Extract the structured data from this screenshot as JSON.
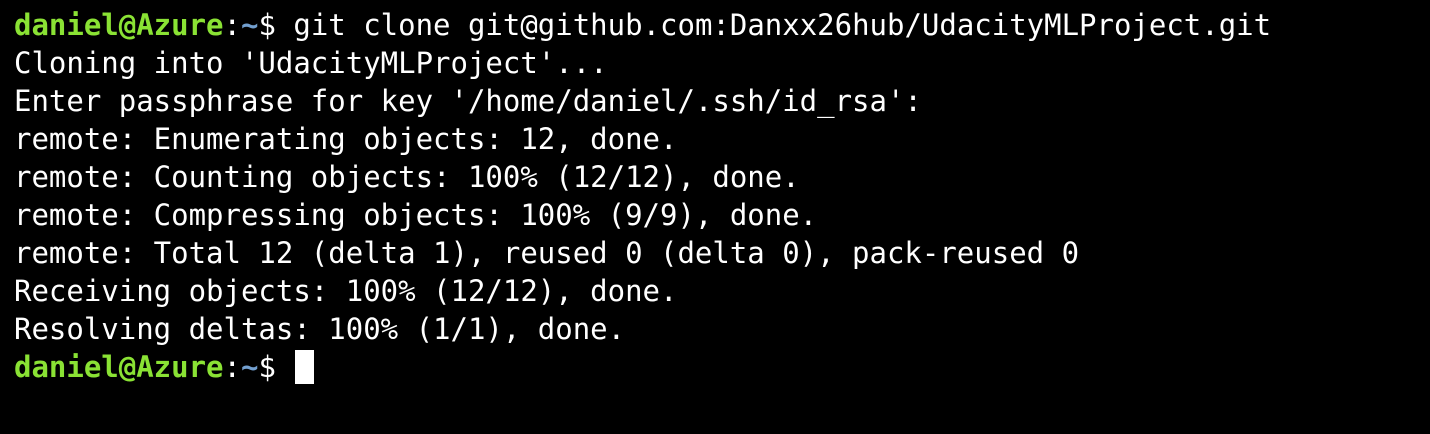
{
  "terminal": {
    "prompt": {
      "user_host": "daniel@Azure",
      "colon": ":",
      "path": "~",
      "symbol": "$ "
    },
    "command": "git clone git@github.com:Danxx26hub/UdacityMLProject.git",
    "output": [
      "Cloning into 'UdacityMLProject'...",
      "Enter passphrase for key '/home/daniel/.ssh/id_rsa':",
      "remote: Enumerating objects: 12, done.",
      "remote: Counting objects: 100% (12/12), done.",
      "remote: Compressing objects: 100% (9/9), done.",
      "remote: Total 12 (delta 1), reused 0 (delta 0), pack-reused 0",
      "Receiving objects: 100% (12/12), done.",
      "Resolving deltas: 100% (1/1), done."
    ]
  },
  "colors": {
    "background": "#000000",
    "text": "#ffffff",
    "prompt_user": "#8ae234",
    "prompt_path": "#729fcf",
    "cursor": "#ffffff"
  }
}
